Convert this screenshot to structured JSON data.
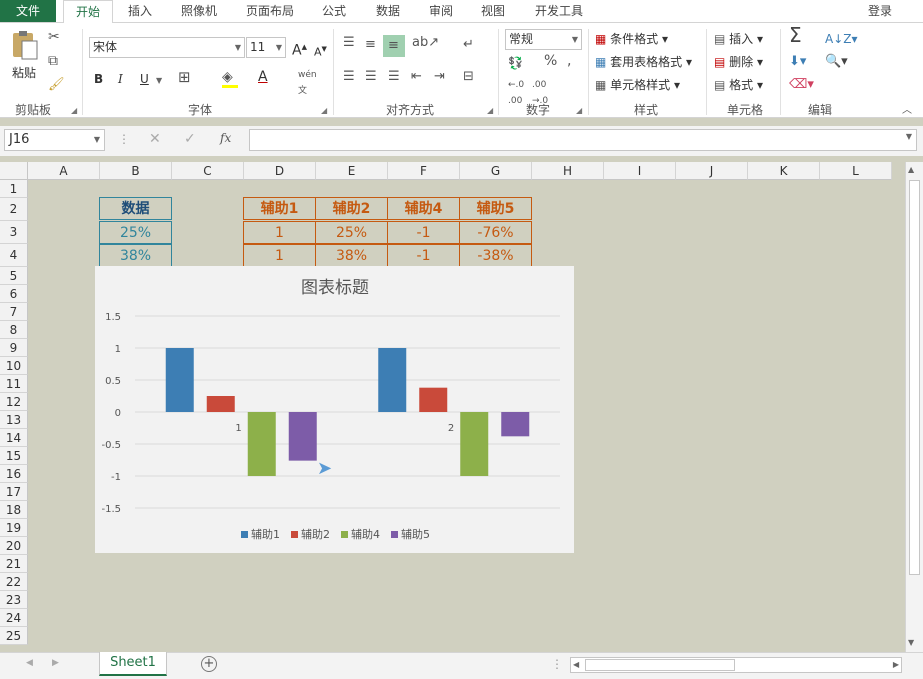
{
  "tabs": {
    "file": "文件",
    "home": "开始",
    "insert": "插入",
    "camera": "照像机",
    "layout": "页面布局",
    "formula": "公式",
    "data": "数据",
    "review": "审阅",
    "view": "视图",
    "developer": "开发工具",
    "login": "登录"
  },
  "ribbon": {
    "clipboard": {
      "label": "剪贴板",
      "paste": "粘贴"
    },
    "font": {
      "label": "字体",
      "name": "宋体",
      "size": "11"
    },
    "align": {
      "label": "对齐方式"
    },
    "number": {
      "label": "数字",
      "format": "常规"
    },
    "styles": {
      "label": "样式",
      "cond": "条件格式",
      "table": "套用表格格式",
      "cell": "单元格样式"
    },
    "cells": {
      "label": "单元格",
      "insert": "插入",
      "delete": "删除",
      "format": "格式"
    },
    "edit": {
      "label": "编辑"
    }
  },
  "formula_bar": {
    "namebox": "J16",
    "fx": "fx"
  },
  "columns": [
    "A",
    "B",
    "C",
    "D",
    "E",
    "F",
    "G",
    "H",
    "I",
    "J",
    "K",
    "L"
  ],
  "rows": [
    "1",
    "2",
    "3",
    "4",
    "5",
    "6",
    "7",
    "8",
    "9",
    "10",
    "11",
    "12",
    "13",
    "14",
    "15",
    "16",
    "17",
    "18",
    "19",
    "20",
    "21",
    "22",
    "23",
    "24",
    "25"
  ],
  "table_b": {
    "header": "数据",
    "values": [
      "25%",
      "38%"
    ]
  },
  "table_d": {
    "headers": [
      "辅助1",
      "辅助2",
      "辅助4",
      "辅助5"
    ],
    "rows": [
      [
        "1",
        "25%",
        "-1",
        "-76%"
      ],
      [
        "1",
        "38%",
        "-1",
        "-38%"
      ]
    ]
  },
  "chart_data": {
    "type": "bar",
    "title": "图表标题",
    "categories": [
      "1",
      "2"
    ],
    "series": [
      {
        "name": "辅助1",
        "values": [
          1,
          1
        ],
        "color": "#3d7eb4"
      },
      {
        "name": "辅助2",
        "values": [
          0.25,
          0.38
        ],
        "color": "#c94a3a"
      },
      {
        "name": "辅助4",
        "values": [
          -1,
          -1
        ],
        "color": "#8db04a"
      },
      {
        "name": "辅助5",
        "values": [
          -0.76,
          -0.38
        ],
        "color": "#7d5ca8"
      }
    ],
    "ylim": [
      -1.5,
      1.5
    ],
    "yticks": [
      "1.5",
      "1",
      "0.5",
      "0",
      "-0.5",
      "-1",
      "-1.5"
    ],
    "grid": true,
    "legend": "bottom"
  },
  "sheetbar": {
    "sheet": "Sheet1"
  }
}
